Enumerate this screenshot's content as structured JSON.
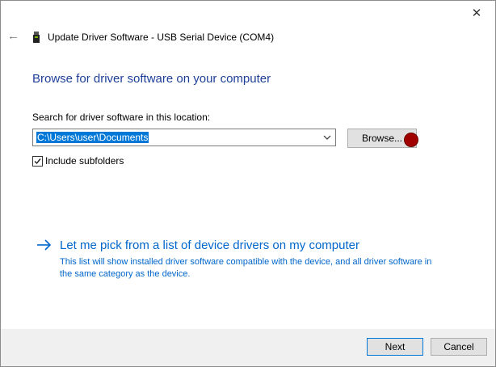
{
  "window": {
    "title": "Update Driver Software - USB Serial Device (COM4)",
    "close_glyph": "✕",
    "back_glyph": "←"
  },
  "main": {
    "heading": "Browse for driver software on your computer",
    "location_label": "Search for driver software in this location:",
    "path_value": "C:\\Users\\user\\Documents",
    "browse_label": "Browse...",
    "include_subfolders": {
      "label": "Include subfolders",
      "checked": true
    },
    "pick_option": {
      "title": "Let me pick from a list of device drivers on my computer",
      "description": "This list will show installed driver software compatible with the device, and all driver software in the same category as the device."
    }
  },
  "footer": {
    "next_label": "Next",
    "cancel_label": "Cancel"
  },
  "colors": {
    "heading": "#1e3f99",
    "link": "#0066cc",
    "selection": "#0078d7",
    "footer_bg": "#f0f0f0"
  }
}
